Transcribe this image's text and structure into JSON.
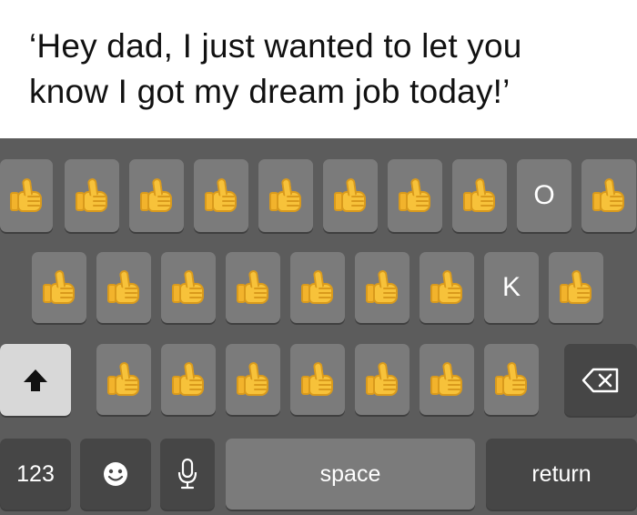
{
  "caption": {
    "line1": "‘Hey dad, I just wanted to let you",
    "line2": "know I got my dream job today!’"
  },
  "keyboard": {
    "row1": [
      "👍",
      "👍",
      "👍",
      "👍",
      "👍",
      "👍",
      "👍",
      "👍",
      "O",
      "👍"
    ],
    "row2": [
      "👍",
      "👍",
      "👍",
      "👍",
      "👍",
      "👍",
      "👍",
      "K",
      "👍"
    ],
    "row3": [
      "shift-icon",
      "👍",
      "👍",
      "👍",
      "👍",
      "👍",
      "👍",
      "👍",
      "delete-icon"
    ],
    "bottom": {
      "numbers_label": "123",
      "space_label": "space",
      "return_label": "return",
      "emoji_icon": "emoji-icon",
      "mic_icon": "microphone-icon"
    }
  }
}
